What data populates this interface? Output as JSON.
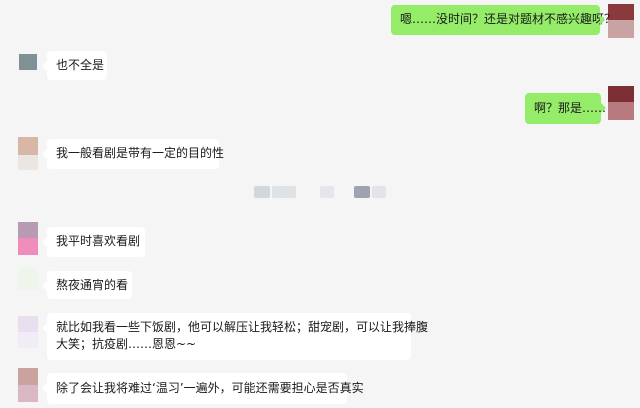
{
  "messages": [
    {
      "side": "out",
      "text": "嗯……没时间？还是对题材不感兴趣呀？"
    },
    {
      "side": "in",
      "text": "也不全是"
    },
    {
      "side": "out",
      "text": "啊？那是……"
    },
    {
      "side": "in",
      "text": "我一般看剧是带有一定的目的性"
    },
    {
      "side": "in",
      "text": "我平时喜欢看剧"
    },
    {
      "side": "in",
      "text": "熬夜通宵的看"
    },
    {
      "side": "in",
      "lines": [
        "就比如我看一些下饭剧，他可以解压让我轻松；甜宠剧，可以让我捧腹",
        "大笑；抗疫剧……恩恩~~"
      ]
    },
    {
      "side": "in",
      "text": "除了会让我将难过‘温习’一遍外，可能还需要担心是否真实"
    }
  ],
  "colors": {
    "background": "#f5f5f5",
    "incoming_bubble": "#ffffff",
    "outgoing_bubble": "#95ec69"
  }
}
